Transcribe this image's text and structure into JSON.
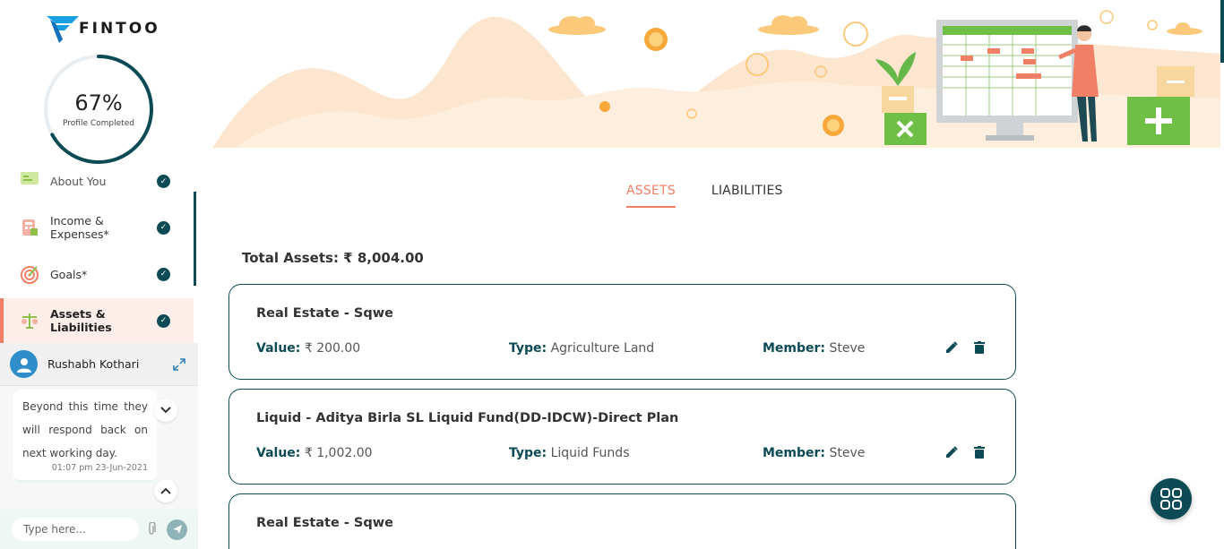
{
  "brand": {
    "name": "FINTOO",
    "accent": "#f07f66",
    "primary": "#0c4b55"
  },
  "profile": {
    "percent_text": "67%",
    "percent": 67,
    "label": "Profile Completed"
  },
  "sidebar": {
    "items": [
      {
        "label": "About You",
        "icon": "person-card-icon",
        "done": true
      },
      {
        "label": "Income & Expenses*",
        "icon": "calculator-icon",
        "done": true
      },
      {
        "label": "Goals*",
        "icon": "target-icon",
        "done": true
      },
      {
        "label": "Assets & Liabilities",
        "icon": "balance-scale-icon",
        "done": true,
        "active": true
      }
    ]
  },
  "chat": {
    "agent_name": "Rushabh Kothari",
    "message": "Beyond this time they will respond back on next working day.",
    "time": "01:07 pm 23-Jun-2021",
    "input_placeholder": "Type here..."
  },
  "tabs": [
    {
      "label": "ASSETS",
      "active": true
    },
    {
      "label": "LIABILITIES",
      "active": false
    }
  ],
  "total_assets": "Total Assets: ₹ 8,004.00",
  "assets": [
    {
      "title": "Real Estate - Sqwe",
      "value_label": "Value:",
      "value": "₹ 200.00",
      "type_label": "Type:",
      "type": "Agriculture Land",
      "member_label": "Member:",
      "member": "Steve"
    },
    {
      "title": "Liquid - Aditya Birla SL Liquid Fund(DD-IDCW)-Direct Plan",
      "value_label": "Value:",
      "value": "₹ 1,002.00",
      "type_label": "Type:",
      "type": "Liquid Funds",
      "member_label": "Member:",
      "member": "Steve"
    },
    {
      "title": "Real Estate - Sqwe"
    }
  ]
}
